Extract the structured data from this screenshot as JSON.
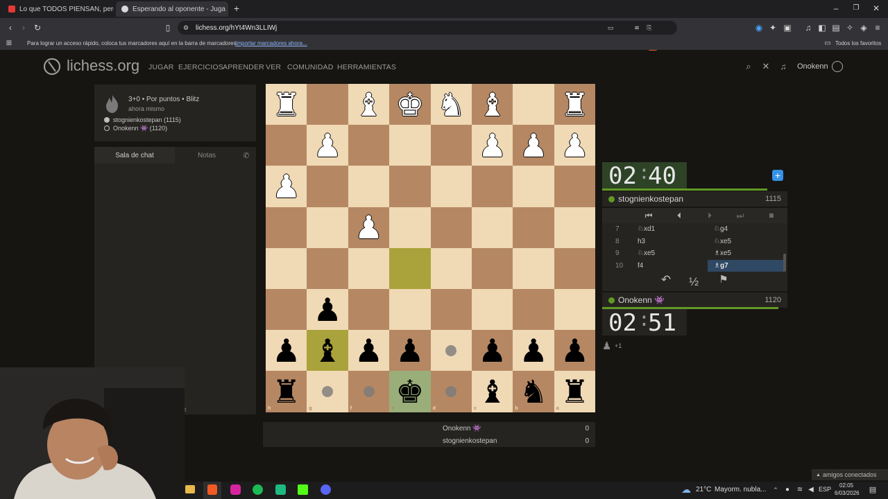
{
  "browser": {
    "tabs": [
      {
        "label": "Lo que TODOS PIENSAN, pero NADIE",
        "color": "#e53935"
      },
      {
        "label": "Esperando al oponente - Juga",
        "color": "#bbbbbb"
      }
    ],
    "url": "lichess.org/hYt4Wn3LLIWj",
    "bookmarks_text": "Para lograr un acceso rápido, coloca tus marcadores aquí en la barra de marcadores.",
    "bookmarks_link": "Importar marcadores ahora...",
    "all_favorites": "Todos los favoritos"
  },
  "site": {
    "logo": "lichess.org",
    "nav": [
      "JUGAR",
      "EJERCICIOS",
      "APRENDER",
      "VER",
      "COMUNIDAD",
      "HERRAMIENTAS"
    ],
    "username": "Onokenn"
  },
  "game_info": {
    "type": "3+0 • Por puntos • Blitz",
    "time": "ahora mismo",
    "player_white": "stognienkostepan (1115)",
    "player_black": "Onokenn 👾 (1120)"
  },
  "chat": {
    "tab_chat": "Sala de chat",
    "tab_notes": "Notas",
    "partial_text": "t"
  },
  "clocks": {
    "top": {
      "min": "02",
      "sec": "40"
    },
    "bottom": {
      "min": "02",
      "sec": "51"
    }
  },
  "players": {
    "top_name": "stognienkostepan",
    "top_rating": "1115",
    "bottom_name": "Onokenn 👾",
    "bottom_rating": "1120"
  },
  "moves": [
    {
      "num": "7",
      "white": "♘xd1",
      "black": "♘g4"
    },
    {
      "num": "8",
      "white": "h3",
      "black": "♘xe5"
    },
    {
      "num": "9",
      "white": "♘xe5",
      "black": "♗xe5"
    },
    {
      "num": "10",
      "white": "f4",
      "black": "♗g7"
    }
  ],
  "controls": {
    "half": "½"
  },
  "material": {
    "advantage": "+1"
  },
  "scores": [
    {
      "name": "Onokenn 👾",
      "score": "0"
    },
    {
      "name": "stognienkostepan",
      "score": "0"
    }
  ],
  "board": {
    "ranks_right": [
      "1",
      "2",
      "3",
      "4",
      "5",
      "6",
      "7",
      "8"
    ],
    "files_bottom": [
      "h",
      "g",
      "f",
      "e",
      "d",
      "c",
      "b",
      "a"
    ],
    "pieces": [
      {
        "sq": [
          0,
          0
        ],
        "p": "♜",
        "c": "w"
      },
      {
        "sq": [
          0,
          2
        ],
        "p": "♝",
        "c": "w"
      },
      {
        "sq": [
          0,
          3
        ],
        "p": "♚",
        "c": "w"
      },
      {
        "sq": [
          0,
          4
        ],
        "p": "♞",
        "c": "w"
      },
      {
        "sq": [
          0,
          5
        ],
        "p": "♝",
        "c": "w"
      },
      {
        "sq": [
          0,
          7
        ],
        "p": "♜",
        "c": "w"
      },
      {
        "sq": [
          1,
          1
        ],
        "p": "♟",
        "c": "w"
      },
      {
        "sq": [
          1,
          5
        ],
        "p": "♟",
        "c": "w"
      },
      {
        "sq": [
          1,
          6
        ],
        "p": "♟",
        "c": "w"
      },
      {
        "sq": [
          1,
          7
        ],
        "p": "♟",
        "c": "w"
      },
      {
        "sq": [
          2,
          0
        ],
        "p": "♟",
        "c": "w"
      },
      {
        "sq": [
          3,
          2
        ],
        "p": "♟",
        "c": "w"
      },
      {
        "sq": [
          5,
          1
        ],
        "p": "♟",
        "c": "b"
      },
      {
        "sq": [
          6,
          0
        ],
        "p": "♟",
        "c": "b"
      },
      {
        "sq": [
          6,
          1
        ],
        "p": "♝",
        "c": "b"
      },
      {
        "sq": [
          6,
          2
        ],
        "p": "♟",
        "c": "b"
      },
      {
        "sq": [
          6,
          3
        ],
        "p": "♟",
        "c": "b"
      },
      {
        "sq": [
          6,
          5
        ],
        "p": "♟",
        "c": "b"
      },
      {
        "sq": [
          6,
          6
        ],
        "p": "♟",
        "c": "b"
      },
      {
        "sq": [
          6,
          7
        ],
        "p": "♟",
        "c": "b"
      },
      {
        "sq": [
          7,
          0
        ],
        "p": "♜",
        "c": "b"
      },
      {
        "sq": [
          7,
          3
        ],
        "p": "♚",
        "c": "b"
      },
      {
        "sq": [
          7,
          5
        ],
        "p": "♝",
        "c": "b"
      },
      {
        "sq": [
          7,
          6
        ],
        "p": "♞",
        "c": "b"
      },
      {
        "sq": [
          7,
          7
        ],
        "p": "♜",
        "c": "b"
      }
    ],
    "highlights": [
      [
        4,
        3
      ],
      [
        6,
        1
      ]
    ],
    "selected": [
      7,
      3
    ],
    "dots": [
      [
        6,
        4
      ],
      [
        7,
        1
      ],
      [
        7,
        2
      ],
      [
        7,
        4
      ]
    ]
  },
  "system": {
    "weather_temp": "21°C",
    "weather_text": "Mayorm. nubla...",
    "lang": "ESP",
    "time": "02:05",
    "date": "6/03/2026",
    "friends": "amigos conectados"
  }
}
